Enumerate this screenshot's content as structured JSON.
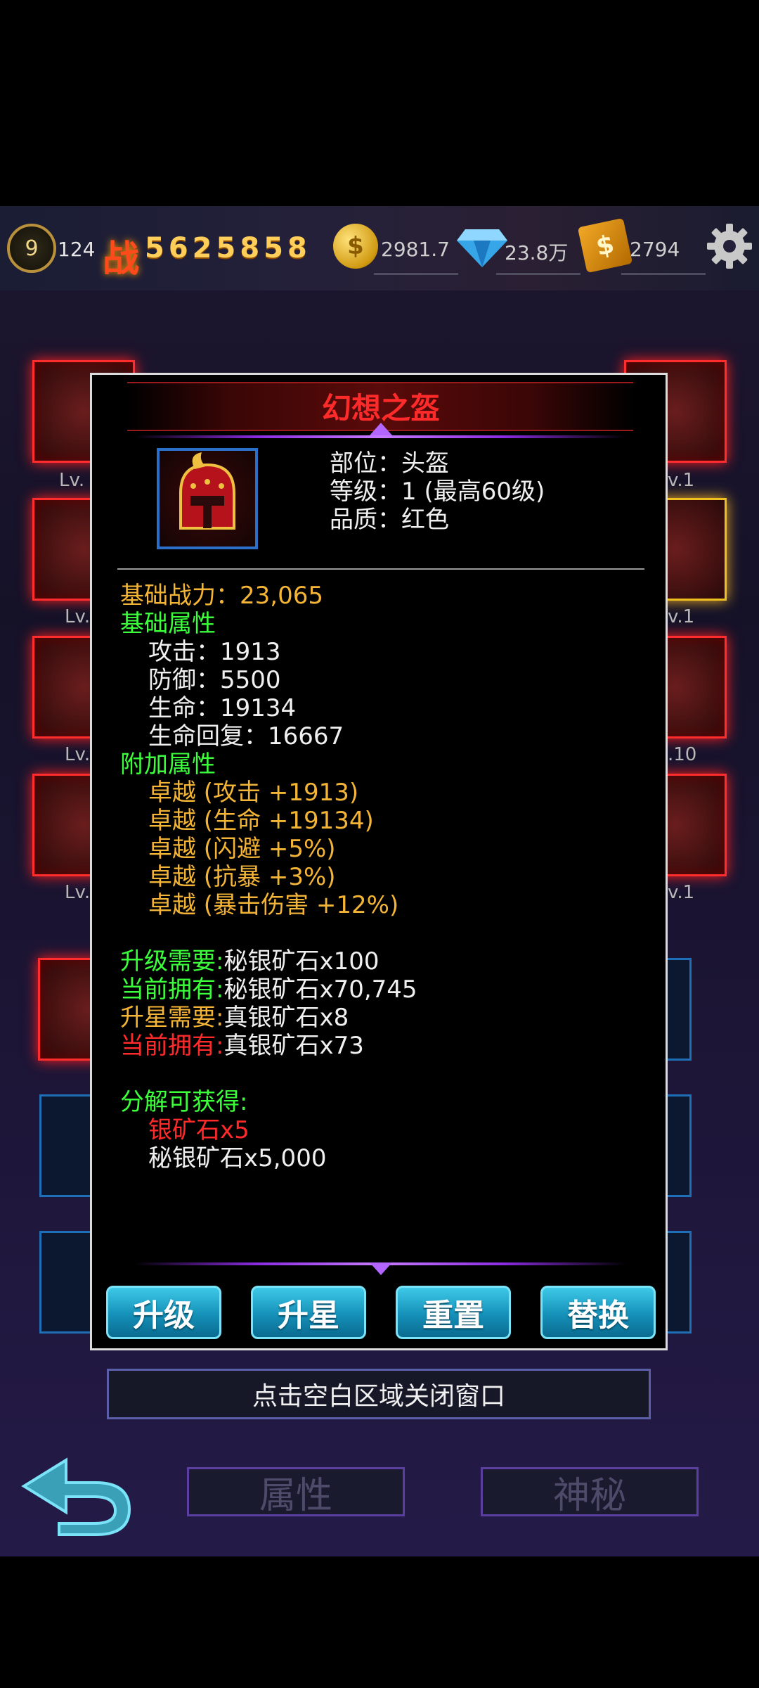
{
  "hud": {
    "level": "9",
    "level_value": "124",
    "power_icon": "战",
    "power": "5625858",
    "gold": "2981.7",
    "diamond": "23.8万",
    "cash": "2794"
  },
  "background": {
    "slot_labels_left": [
      "Lv.",
      "Lv.",
      "Lv.",
      "Lv."
    ],
    "slot_labels_right": [
      "v.1",
      "v.1",
      ".10",
      "v.1"
    ],
    "nav_attr": "属性",
    "nav_mystery": "神秘"
  },
  "popup": {
    "title": "幻想之盔",
    "part_label": "部位：",
    "part_value": "头盔",
    "level_label": "等级：",
    "level_value": "1  (最高60级)",
    "quality_label": "品质：",
    "quality_value": "红色",
    "base_power_label": "基础战力：",
    "base_power_value": "23,065",
    "base_attr_header": "基础属性",
    "base_attrs": [
      {
        "label": "攻击：",
        "value": "1913"
      },
      {
        "label": "防御：",
        "value": "5500"
      },
      {
        "label": "生命：",
        "value": "19134"
      },
      {
        "label": "生命回复：",
        "value": "16667"
      }
    ],
    "extra_attr_header": "附加属性",
    "extra_attrs": [
      "卓越 (攻击 +1913)",
      "卓越 (生命 +19134)",
      "卓越 (闪避 +5%)",
      "卓越 (抗暴 +3%)",
      "卓越 (暴击伤害 +12%)"
    ],
    "upgrade_need_label": "升级需要:",
    "upgrade_need_value": "秘银矿石x100",
    "upgrade_have_label": "当前拥有:",
    "upgrade_have_value": "秘银矿石x70,745",
    "star_need_label": "升星需要:",
    "star_need_value": "真银矿石x8",
    "star_have_label": "当前拥有:",
    "star_have_value": "真银矿石x73",
    "decompose_header": "分解可获得:",
    "decompose_items": [
      "银矿石x5",
      "秘银矿石x5,000"
    ],
    "buttons": [
      "升级",
      "升星",
      "重置",
      "替换"
    ]
  },
  "hint": "点击空白区域关闭窗口",
  "colors": {
    "title_red": "#ff2a2a",
    "gold": "#f4b536",
    "green": "#3cff3c",
    "button_cyan": "#1590b8"
  }
}
